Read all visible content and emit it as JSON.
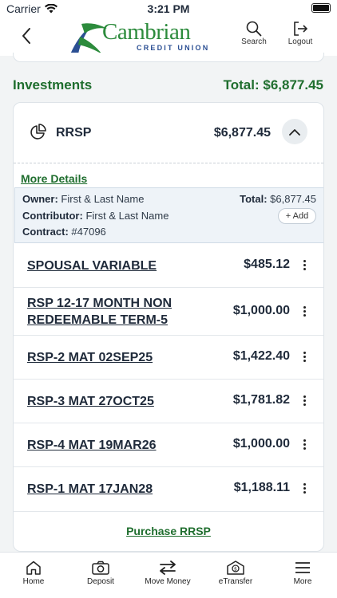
{
  "status_bar": {
    "carrier": "Carrier",
    "time": "3:21 PM"
  },
  "header": {
    "logo_name": "Cambrian",
    "logo_sub": "CREDIT UNION",
    "search_label": "Search",
    "logout_label": "Logout"
  },
  "investments": {
    "title": "Investments",
    "total": "Total: $6,877.45"
  },
  "account": {
    "name": "RRSP",
    "balance": "$6,877.45",
    "more_details": "More Details",
    "owner_label": "Owner:",
    "owner_value": "First & Last Name",
    "contributor_label": "Contributor:",
    "contributor_value": "First & Last Name",
    "contract_label": "Contract:",
    "contract_value": "#47096",
    "total_label": "Total:",
    "total_value": "$6,877.45",
    "add_label": "+ Add",
    "sub_accounts": [
      {
        "name": "SPOUSAL VARIABLE",
        "amount": "$485.12"
      },
      {
        "name": "RSP 12-17 MONTH NON REDEEMABLE TERM-5",
        "amount": "$1,000.00"
      },
      {
        "name": "RSP-2 MAT 02SEP25",
        "amount": "$1,422.40"
      },
      {
        "name": "RSP-3 MAT 27OCT25",
        "amount": "$1,781.82"
      },
      {
        "name": "RSP-4 MAT 19MAR26",
        "amount": "$1,000.00"
      },
      {
        "name": "RSP-1 MAT 17JAN28",
        "amount": "$1,188.11"
      }
    ],
    "purchase_label": "Purchase RRSP"
  },
  "tabbar": {
    "items": [
      {
        "label": "Home",
        "icon": "home-icon"
      },
      {
        "label": "Deposit",
        "icon": "camera-icon"
      },
      {
        "label": "Move Money",
        "icon": "transfer-arrows-icon"
      },
      {
        "label": "eTransfer",
        "icon": "etransfer-icon"
      },
      {
        "label": "More",
        "icon": "hamburger-icon"
      }
    ]
  },
  "colors": {
    "brand_green": "#1f6e2e",
    "brand_blue": "#2b4f93",
    "text_dark": "#1f2a3a"
  }
}
